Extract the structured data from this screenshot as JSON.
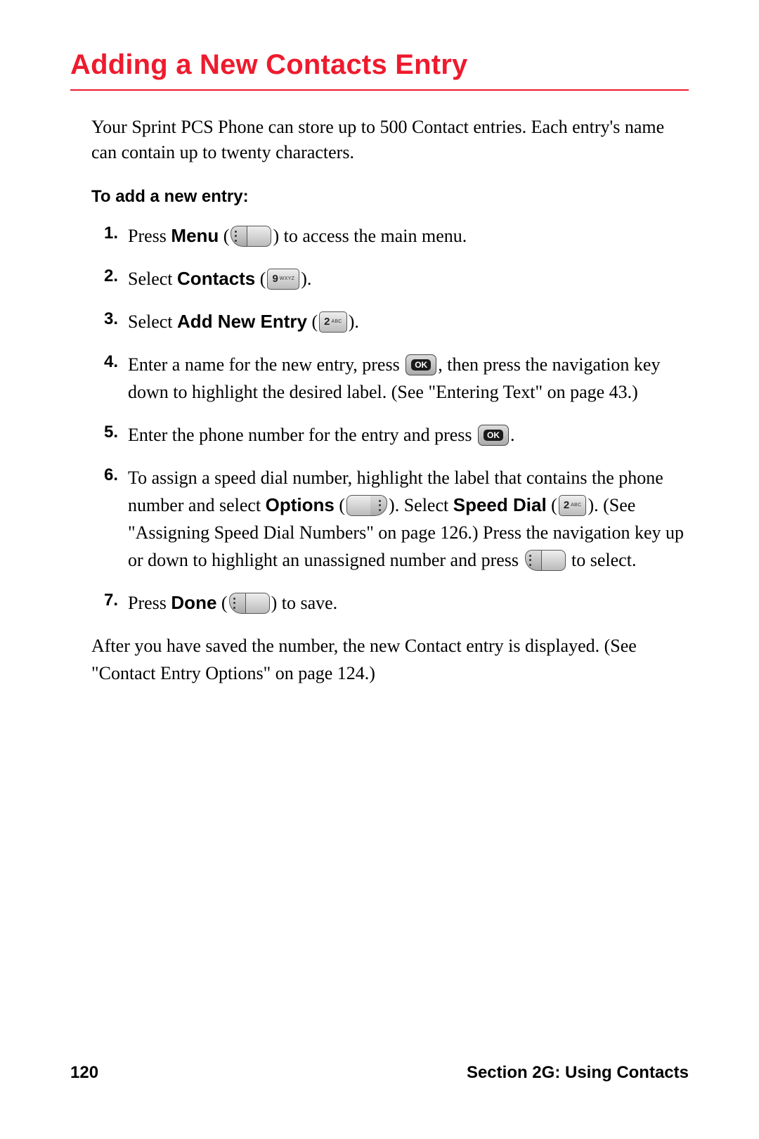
{
  "title": "Adding a New Contacts Entry",
  "intro": "Your Sprint PCS Phone can store up to 500 Contact entries. Each entry's name can contain up to twenty characters.",
  "subhead": "To add a new entry:",
  "steps": {
    "s1": {
      "num": "1.",
      "a": "Press ",
      "bold1": "Menu",
      "b": " (",
      "c": ") to access the main menu."
    },
    "s2": {
      "num": "2.",
      "a": "Select ",
      "bold1": "Contacts",
      "b": " (",
      "c": ")."
    },
    "s3": {
      "num": "3.",
      "a": "Select ",
      "bold1": "Add New Entry",
      "b": " (",
      "c": ")."
    },
    "s4": {
      "num": "4.",
      "a": "Enter a name for the new entry, press ",
      "b": ", then press the navigation key down to highlight the desired label. (See \"Entering Text\" on page 43.)"
    },
    "s5": {
      "num": "5.",
      "a": "Enter the phone number for the entry and press ",
      "b": "."
    },
    "s6": {
      "num": "6.",
      "a": "To assign a speed dial number, highlight the label that contains the phone number and select ",
      "bold1": "Options",
      "b": " (",
      "c": "). Select ",
      "bold2": "Speed Dial",
      "d": " (",
      "e": "). (See \"Assigning Speed Dial Numbers\" on page 126.) Press the navigation key up or down to highlight an unassigned number and press ",
      "f": " to select."
    },
    "s7": {
      "num": "7.",
      "a": "Press ",
      "bold1": "Done",
      "b": " (",
      "c": ") to save."
    }
  },
  "outro": "After you have saved the number, the new Contact entry is displayed. (See \"Contact Entry Options\" on page 124.)",
  "keys": {
    "ok": "OK",
    "key9_big": "9",
    "key9_sm": "WXYZ",
    "key2_big": "2",
    "key2_sm": "ABC"
  },
  "footer": {
    "page": "120",
    "section": "Section 2G: Using Contacts"
  }
}
